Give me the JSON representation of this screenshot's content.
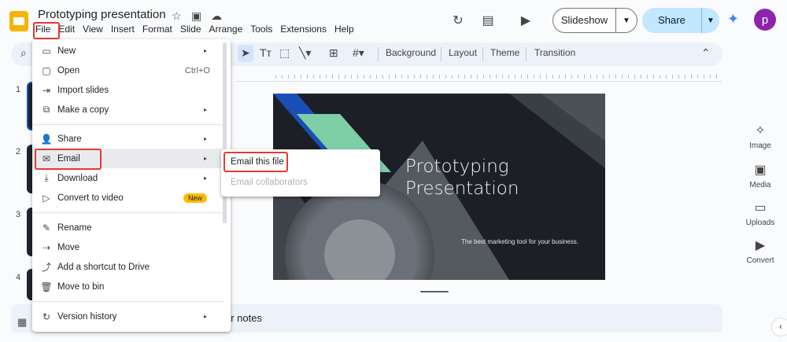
{
  "app": {
    "title": "Prototyping presentation",
    "star_icon": "☆",
    "folder_icon": "▣",
    "cloud_icon": "☁"
  },
  "menubar": [
    "File",
    "Edit",
    "View",
    "Insert",
    "Format",
    "Slide",
    "Arrange",
    "Tools",
    "Extensions",
    "Help"
  ],
  "header": {
    "slideshow_label": "Slideshow",
    "share_label": "Share",
    "avatar_letter": "p",
    "history_icon": "↻",
    "comment_icon": "▤",
    "video_icon": "▶"
  },
  "toolbar": {
    "background_label": "Background",
    "layout_label": "Layout",
    "theme_label": "Theme",
    "transition_label": "Transition",
    "search_icon": "⌕",
    "textbox_icon": "Tт"
  },
  "filmstrip": {
    "numbers": [
      "1",
      "2",
      "3",
      "4"
    ]
  },
  "slide": {
    "title_line1": "Prototyping",
    "title_line2": "Presentation",
    "subtitle": "The best marketing tool for your business."
  },
  "notes": {
    "label": "er notes"
  },
  "side_panel": {
    "image_label": "Image",
    "media_label": "Media",
    "uploads_label": "Uploads",
    "convert_label": "Convert"
  },
  "file_menu": {
    "items": [
      {
        "label": "New",
        "icon": "▭",
        "arrow": "▸"
      },
      {
        "label": "Open",
        "icon": "▢",
        "shortcut": "Ctrl+O"
      },
      {
        "label": "Import slides",
        "icon": "⇥"
      },
      {
        "label": "Make a copy",
        "icon": "⧉",
        "arrow": "▸"
      },
      {
        "label": "Share",
        "icon": "👤",
        "arrow": "▸"
      },
      {
        "label": "Email",
        "icon": "✉",
        "arrow": "▸"
      },
      {
        "label": "Download",
        "icon": "⤓",
        "arrow": "▸"
      },
      {
        "label": "Convert to video",
        "icon": "▷",
        "badge": "New"
      },
      {
        "label": "Rename",
        "icon": "✎"
      },
      {
        "label": "Move",
        "icon": "⇢"
      },
      {
        "label": "Add a shortcut to Drive",
        "icon": "⤴"
      },
      {
        "label": "Move to bin",
        "icon": "🗑"
      },
      {
        "label": "Version history",
        "icon": "↻",
        "arrow": "▸"
      }
    ]
  },
  "email_submenu": {
    "email_this_file": "Email this file",
    "email_collaborators": "Email collaborators"
  },
  "colors": {
    "highlight": "#e53935",
    "accent": "#0b57d0",
    "share_bg": "#c2e7ff"
  }
}
